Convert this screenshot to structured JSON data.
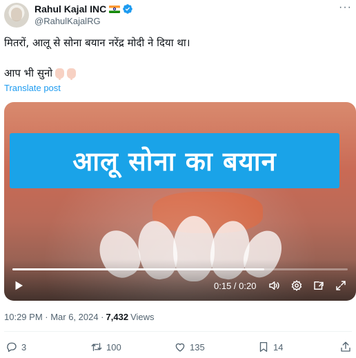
{
  "author": {
    "display_name": "Rahul Kajal INC",
    "handle": "@RahulKajalRG"
  },
  "tweet": {
    "text_line1": "मितरों, आलू से सोना बयान नरेंद्र मोदी ने दिया था।",
    "text_line2": "आप भी सुनो",
    "translate_label": "Translate post"
  },
  "video": {
    "banner_text": "आलू सोना का बयान",
    "time_display": "0:15 / 0:20",
    "progress_fraction": 0.75
  },
  "meta": {
    "timestamp": "10:29 PM · Mar 6, 2024 ·",
    "views_count": "7,432",
    "views_label": "Views"
  },
  "actions": {
    "replies": "3",
    "reposts": "100",
    "likes": "135",
    "bookmarks": "14"
  },
  "colors": {
    "accent": "#1d9bf0",
    "secondary_text": "#536471",
    "banner": "#1aa3e8"
  }
}
